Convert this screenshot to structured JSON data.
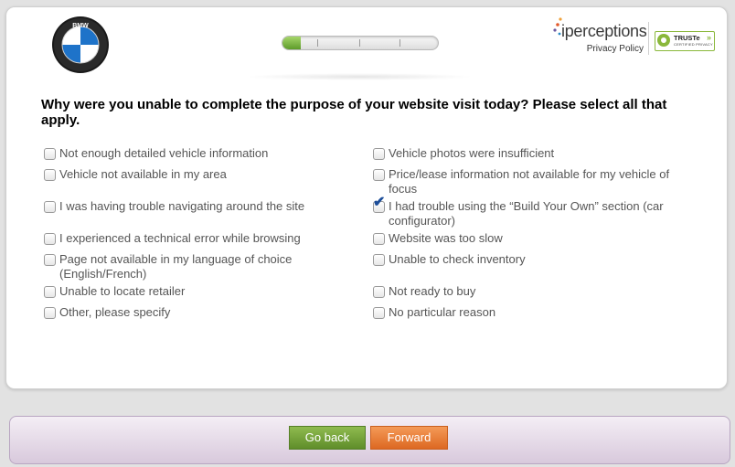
{
  "header": {
    "brand_name": "BMW",
    "progress": {
      "value": 0.12,
      "segments": 4
    },
    "vendor": {
      "name": "iperceptions",
      "privacy_link": "Privacy Policy"
    },
    "seal": {
      "name": "TRUSTe",
      "subtitle": "CERTIFIED PRIVACY"
    }
  },
  "question": "Why were you unable to complete the purpose of your website visit today? Please select all that apply.",
  "options": {
    "left": [
      {
        "label": "Not enough detailed vehicle information",
        "checked": false
      },
      {
        "label": "Vehicle not available in my area",
        "checked": false
      },
      {
        "label": "I was having trouble navigating around the site",
        "checked": false
      },
      {
        "label": "I experienced a technical error while browsing",
        "checked": false
      },
      {
        "label": "Page not available in my language of choice (English/French)",
        "checked": false
      },
      {
        "label": "Unable to locate retailer",
        "checked": false
      },
      {
        "label": "Other, please specify",
        "checked": false
      }
    ],
    "right": [
      {
        "label": "Vehicle photos were insufficient",
        "checked": false
      },
      {
        "label": "Price/lease information not available for my vehicle of focus",
        "checked": false
      },
      {
        "label": "I had trouble using the “Build Your Own” section (car configurator)",
        "checked": true
      },
      {
        "label": "Website was too slow",
        "checked": false
      },
      {
        "label": "Unable to check inventory",
        "checked": false
      },
      {
        "label": "Not ready to buy",
        "checked": false
      },
      {
        "label": "No particular reason",
        "checked": false
      }
    ]
  },
  "footer": {
    "back_label": "Go back",
    "forward_label": "Forward"
  },
  "colors": {
    "accent_green": "#6f9f33",
    "accent_orange": "#e97a33",
    "check_blue": "#1d4e9a"
  }
}
